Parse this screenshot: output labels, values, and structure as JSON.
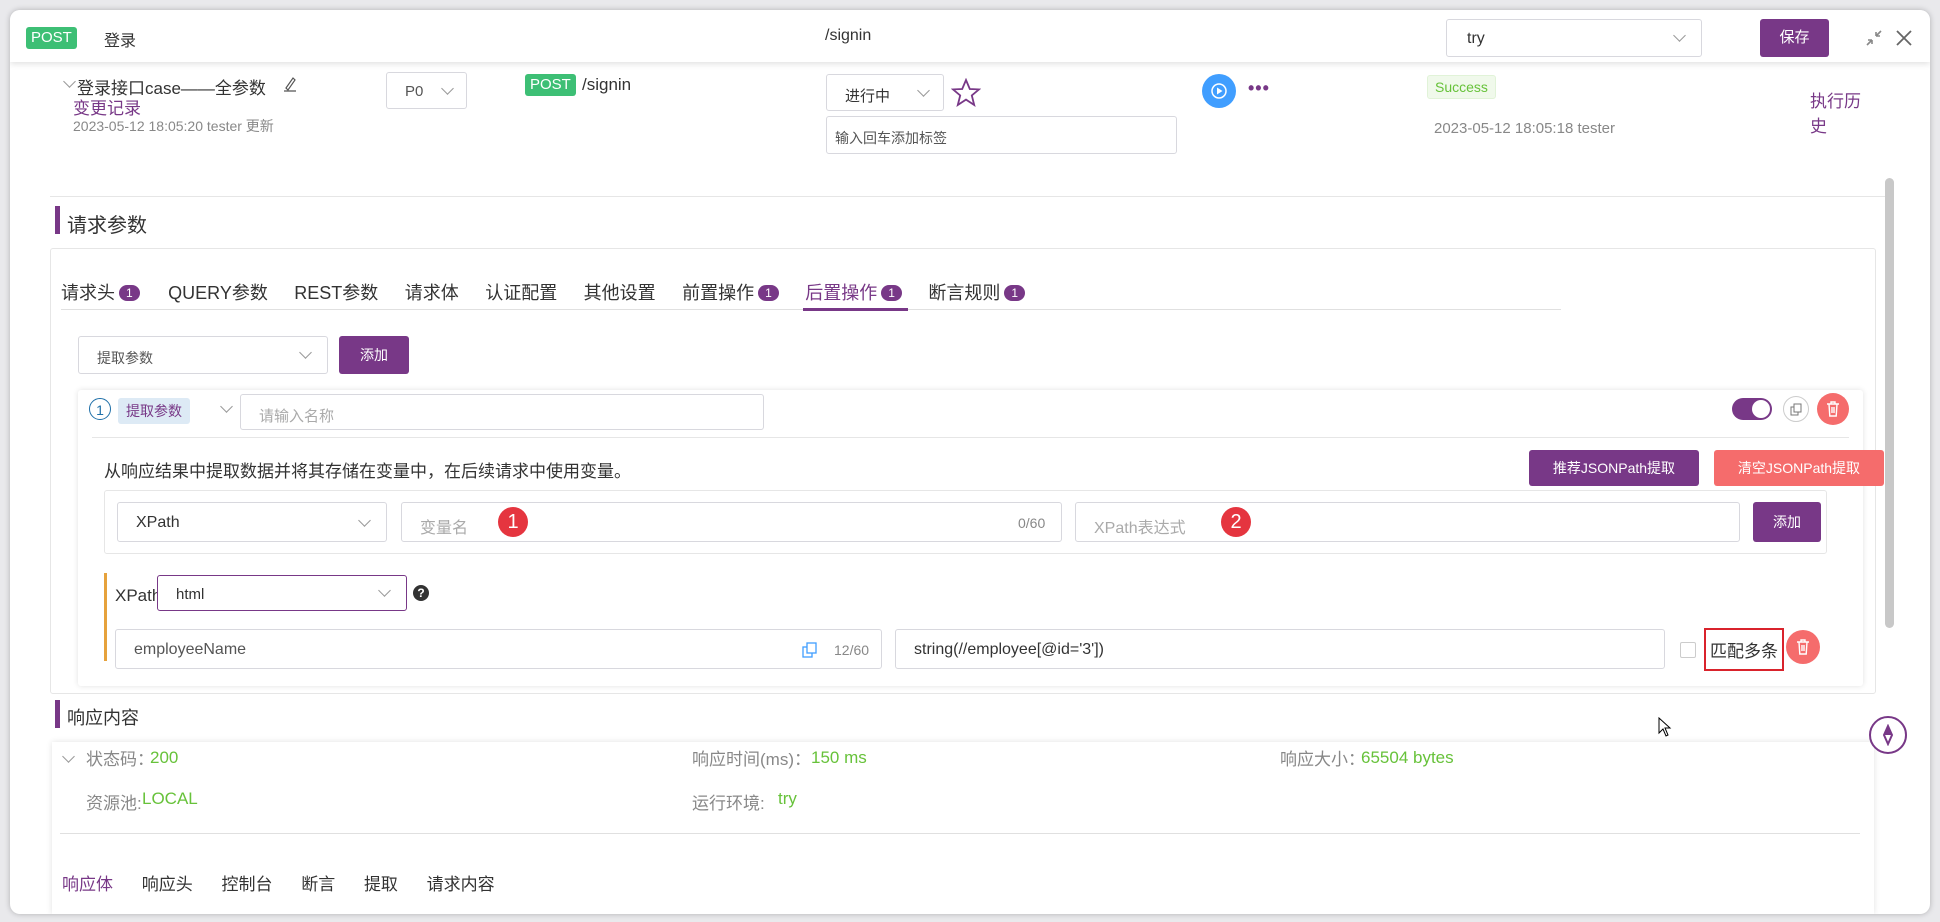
{
  "topbar": {
    "method": "POST",
    "name": "登录",
    "path": "/signin",
    "env_select": "try",
    "save_label": "保存"
  },
  "case": {
    "title": "登录接口case——全参数",
    "change_log": "变更记录",
    "updated": "2023-05-12 18:05:20 tester 更新",
    "priority": "P0",
    "method": "POST",
    "path": "/signin",
    "status": "进行中",
    "tag_placeholder": "输入回车添加标签",
    "result": "Success",
    "result_time": "2023-05-12 18:05:18 tester",
    "history": "执行历史"
  },
  "request": {
    "section_title": "请求参数",
    "tabs": [
      {
        "label": "请求头",
        "badge": "1"
      },
      {
        "label": "QUERY参数",
        "badge": ""
      },
      {
        "label": "REST参数",
        "badge": ""
      },
      {
        "label": "请求体",
        "badge": ""
      },
      {
        "label": "认证配置",
        "badge": ""
      },
      {
        "label": "其他设置",
        "badge": ""
      },
      {
        "label": "前置操作",
        "badge": "1"
      },
      {
        "label": "后置操作",
        "badge": "1"
      },
      {
        "label": "断言规则",
        "badge": "1"
      }
    ],
    "op_select": "提取参数",
    "add_label": "添加",
    "item": {
      "index": "1",
      "type_tag": "提取参数",
      "name_placeholder": "请输入名称",
      "description": "从响应结果中提取数据并将其存储在变量中，在后续请求中使用变量。",
      "recommend_btn": "推荐JSONPath提取",
      "clear_btn": "清空JSONPath提取",
      "extract_type": "XPath",
      "var_placeholder": "变量名",
      "var_count": "0/60",
      "expr_placeholder": "XPath表达式",
      "marker1": "1",
      "marker2": "2",
      "add_label": "添加",
      "xpath_label": "XPath",
      "xpath_mode": "html",
      "help": "?",
      "row_var": "employeeName",
      "row_count": "12/60",
      "row_expr": "string(//employee[@id='3'])",
      "match_multi": "匹配多条"
    }
  },
  "response": {
    "section_title": "响应内容",
    "status_label": "状态码：",
    "status_value": "200",
    "time_label": "响应时间(ms)：",
    "time_value": "150 ms",
    "size_label": "响应大小：",
    "size_value": "65504 bytes",
    "pool_label": "资源池:",
    "pool_value": "LOCAL",
    "env_label": "运行环境:",
    "env_value": "try",
    "tabs": [
      "响应体",
      "响应头",
      "控制台",
      "断言",
      "提取",
      "请求内容"
    ]
  },
  "colors": {
    "brand": "#783887",
    "danger": "#f56c6c",
    "success": "#67c23a",
    "method": "#3dbf75"
  }
}
